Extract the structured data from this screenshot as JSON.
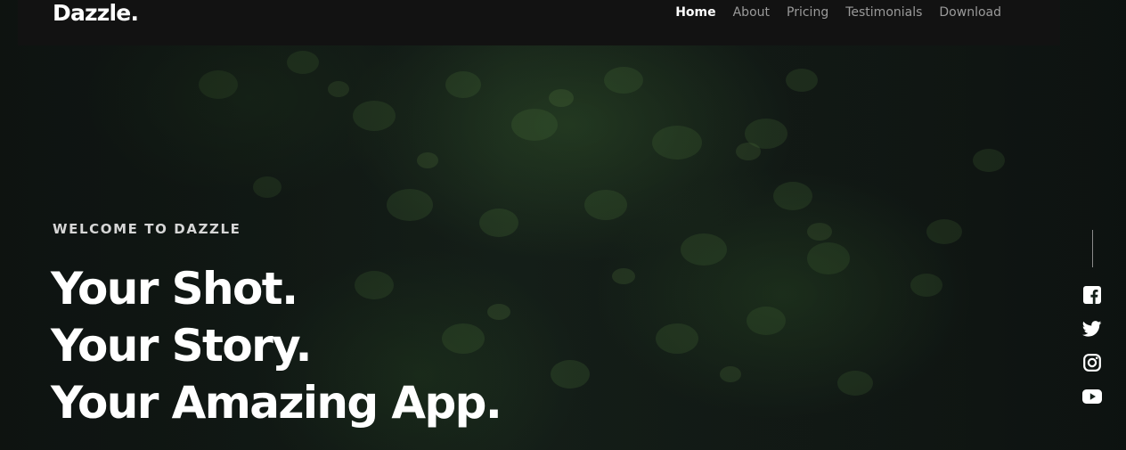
{
  "brand": {
    "logo_text": "Dazzle."
  },
  "nav": {
    "items": [
      {
        "label": "Home",
        "active": true
      },
      {
        "label": "About",
        "active": false
      },
      {
        "label": "Pricing",
        "active": false
      },
      {
        "label": "Testimonials",
        "active": false
      },
      {
        "label": "Download",
        "active": false
      }
    ]
  },
  "hero": {
    "eyebrow": "WELCOME TO DAZZLE",
    "headline_lines": [
      "Your Shot.",
      "Your Story.",
      "Your Amazing App."
    ],
    "background": "dark green leaves photo"
  },
  "social": {
    "icons": [
      "facebook-icon",
      "twitter-icon",
      "instagram-icon",
      "youtube-icon"
    ]
  },
  "colors": {
    "navbar_bg": "#121212",
    "nav_active": "#ffffff",
    "nav_inactive": "#9a9a9a",
    "text_primary": "#ffffff",
    "eyebrow": "#d6d6d6"
  }
}
